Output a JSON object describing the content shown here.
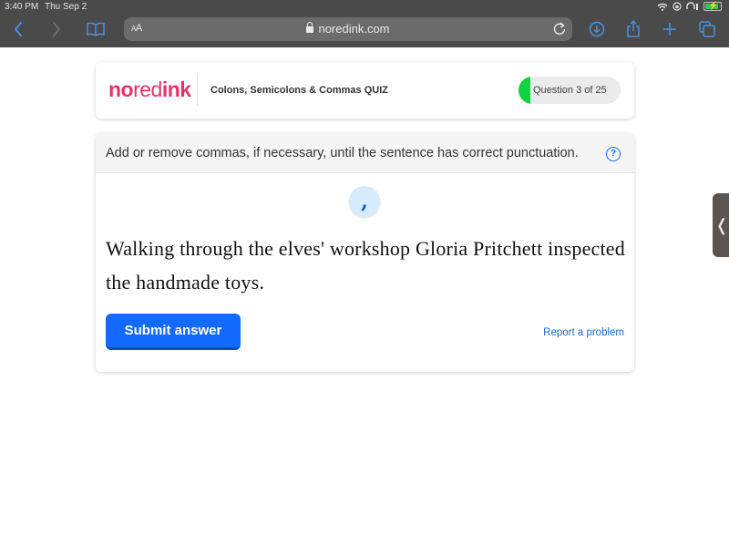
{
  "status_bar": {
    "time": "3:40 PM",
    "date": "Thu Sep 2",
    "battery_percent": 70
  },
  "browser": {
    "text_size_label_small": "A",
    "text_size_label_large": "A",
    "url_host": "noredink.com",
    "accent_color": "#4a90e2"
  },
  "header": {
    "logo_no": "no",
    "logo_red": "red",
    "logo_ink": "ink",
    "quiz_title": "Colons, Semicolons & Commas QUIZ",
    "progress_label": "Question 3 of 25",
    "progress_current": 3,
    "progress_total": 25
  },
  "question": {
    "prompt": "Add or remove commas, if necessary, until the sentence has correct punctuation.",
    "help_icon_glyph": "?",
    "comma_glyph": ",",
    "sentence": "Walking through the elves' workshop Gloria Pritchett inspected the handmade toys.",
    "submit_label": "Submit answer",
    "report_label": "Report a problem"
  },
  "side_handle": {
    "glyph": "❬"
  },
  "colors": {
    "brand": "#e2336b",
    "primary_button": "#146aff",
    "progress_fill": "#0fd33f",
    "link": "#1f66c4"
  }
}
